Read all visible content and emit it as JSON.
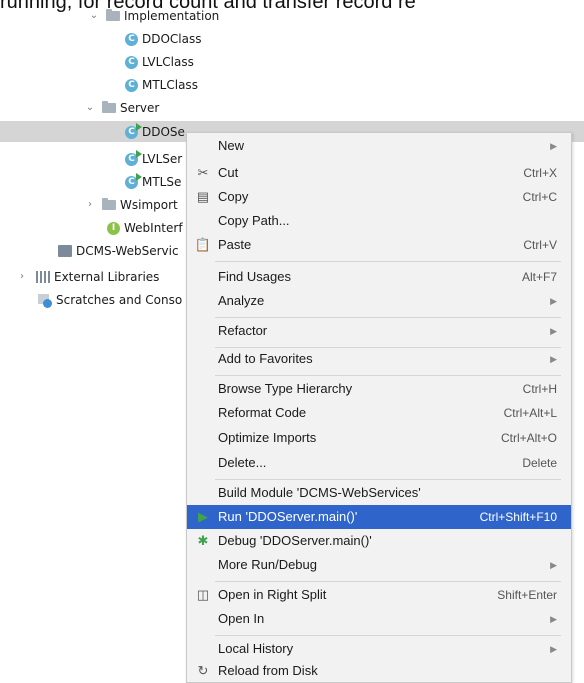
{
  "caption": "running, for record count and transfer record re",
  "tree": {
    "implementation_label": "Implementation",
    "impl_classes": [
      "DDOClass",
      "LVLClass",
      "MTLClass"
    ],
    "server_label": "Server",
    "server_classes": [
      "DDOSe",
      "LVLSer",
      "MTLSe"
    ],
    "wsimport_label": "Wsimport",
    "webinterface_label": "WebInterf",
    "module_label": "DCMS-WebServic",
    "external_libraries_label": "External Libraries",
    "scratches_label": "Scratches and Conso",
    "class_icon_letter": "C",
    "interface_icon_letter": "I"
  },
  "menu": {
    "items": [
      {
        "label": "New",
        "shortcut": "",
        "submenu": true
      },
      {
        "label": "Cut",
        "shortcut": "Ctrl+X",
        "icon": "cut-icon"
      },
      {
        "label": "Copy",
        "shortcut": "Ctrl+C",
        "icon": "copy-icon"
      },
      {
        "label": "Copy Path...",
        "shortcut": ""
      },
      {
        "label": "Paste",
        "shortcut": "Ctrl+V",
        "icon": "paste-icon"
      },
      {
        "label": "Find Usages",
        "shortcut": "Alt+F7"
      },
      {
        "label": "Analyze",
        "shortcut": "",
        "submenu": true
      },
      {
        "label": "Refactor",
        "shortcut": "",
        "submenu": true
      },
      {
        "label": "Add to Favorites",
        "shortcut": "",
        "submenu": true
      },
      {
        "label": "Browse Type Hierarchy",
        "shortcut": "Ctrl+H"
      },
      {
        "label": "Reformat Code",
        "shortcut": "Ctrl+Alt+L"
      },
      {
        "label": "Optimize Imports",
        "shortcut": "Ctrl+Alt+O"
      },
      {
        "label": "Delete...",
        "shortcut": "Delete"
      },
      {
        "label": "Build Module 'DCMS-WebServices'",
        "shortcut": ""
      },
      {
        "label": "Run 'DDOServer.main()'",
        "shortcut": "Ctrl+Shift+F10",
        "icon": "run-icon",
        "highlighted": true
      },
      {
        "label": "Debug 'DDOServer.main()'",
        "shortcut": "",
        "icon": "debug-icon"
      },
      {
        "label": "More Run/Debug",
        "shortcut": "",
        "submenu": true
      },
      {
        "label": "Open in Right Split",
        "shortcut": "Shift+Enter",
        "icon": "split-icon"
      },
      {
        "label": "Open In",
        "shortcut": "",
        "submenu": true
      },
      {
        "label": "Local History",
        "shortcut": "",
        "submenu": true
      },
      {
        "label": "Reload from Disk",
        "shortcut": "",
        "icon": "reload-icon"
      }
    ]
  },
  "colors": {
    "highlight": "#2f65ca",
    "menu_bg": "#f2f2f2",
    "selected_row": "#d5d5d5",
    "run_green": "#3fa24e"
  }
}
